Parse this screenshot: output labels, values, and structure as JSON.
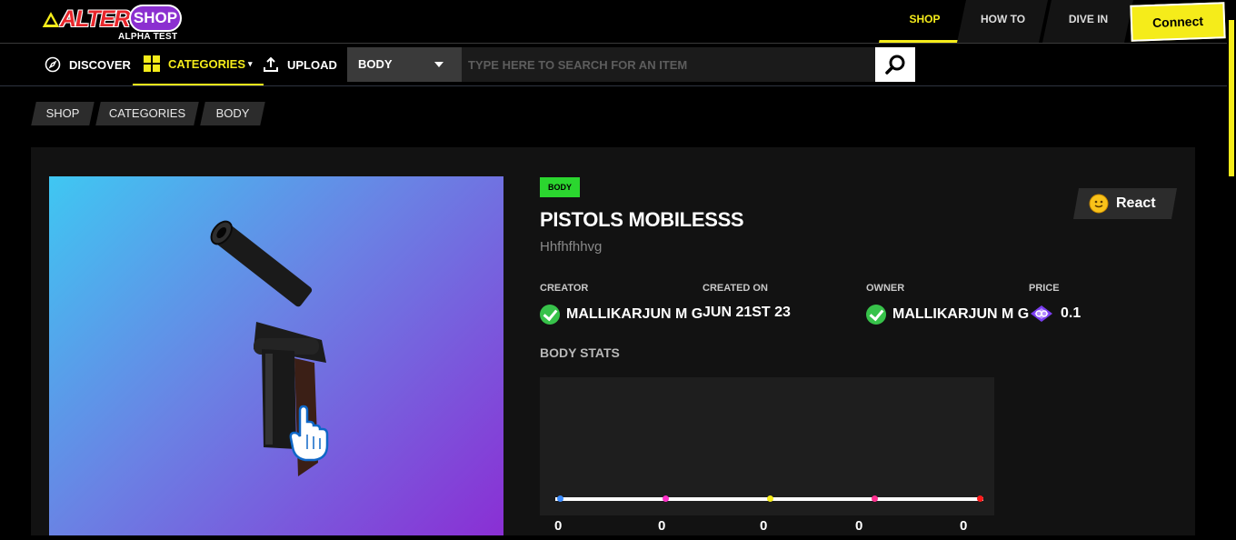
{
  "brand": {
    "name": "ALTER",
    "badge": "SHOP",
    "subtitle": "ALPHA TEST"
  },
  "header": {
    "tabs": [
      {
        "label": "SHOP",
        "active": true
      },
      {
        "label": "HOW TO",
        "active": false
      },
      {
        "label": "DIVE IN",
        "active": false
      }
    ],
    "connect_label": "Connect"
  },
  "subnav": {
    "discover": "DISCOVER",
    "categories": "CATEGORIES",
    "upload": "UPLOAD",
    "select_value": "BODY",
    "search_placeholder": "TYPE HERE TO SEARCH FOR AN ITEM"
  },
  "breadcrumb": [
    "SHOP",
    "CATEGORIES",
    "BODY"
  ],
  "item": {
    "type": "BODY",
    "title": "PISTOLS MOBILESSS",
    "description": "Hhfhfhhvg",
    "react_label": "React",
    "creator_label": "CREATOR",
    "creator": "MALLIKARJUN M G",
    "created_label": "CREATED ON",
    "created": "JUN 21ST 23",
    "owner_label": "OWNER",
    "owner": "MALLIKARJUN M G",
    "price_label": "PRICE",
    "price": "0.1"
  },
  "stats": {
    "title": "BODY STATS",
    "values": [
      "0",
      "0",
      "0",
      "0",
      "0"
    ],
    "dot_colors": [
      "#3b8cff",
      "#ff2fc8",
      "#f5ec1a",
      "#ff2f8f",
      "#ff1a1a"
    ]
  },
  "colors": {
    "accent": "#f5ec1a",
    "badge": "#2bd62f",
    "panel": "#121212"
  }
}
